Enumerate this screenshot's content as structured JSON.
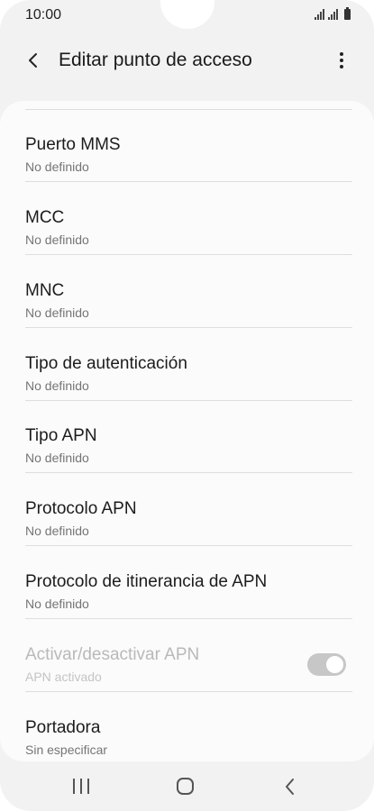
{
  "status_bar": {
    "time": "10:00"
  },
  "app_bar": {
    "title": "Editar punto de acceso",
    "back_icon": "chevron-left-icon",
    "more_icon": "more-vertical-icon"
  },
  "settings": {
    "items": [
      {
        "title": "Puerto MMS",
        "subtitle": "No definido",
        "enabled": true
      },
      {
        "title": "MCC",
        "subtitle": "No definido",
        "enabled": true
      },
      {
        "title": "MNC",
        "subtitle": "No definido",
        "enabled": true
      },
      {
        "title": "Tipo de autenticación",
        "subtitle": "No definido",
        "enabled": true
      },
      {
        "title": "Tipo APN",
        "subtitle": "No definido",
        "enabled": true
      },
      {
        "title": "Protocolo APN",
        "subtitle": "No definido",
        "enabled": true
      },
      {
        "title": "Protocolo de itinerancia de APN",
        "subtitle": "No definido",
        "enabled": true
      },
      {
        "title": "Activar/desactivar APN",
        "subtitle": "APN activado",
        "enabled": false,
        "toggle_on": true
      },
      {
        "title": "Portadora",
        "subtitle": "Sin especificar",
        "enabled": true
      }
    ]
  },
  "nav_bar": {
    "recents_icon": "recents-icon",
    "home_icon": "home-icon",
    "back_icon": "back-icon"
  },
  "colors": {
    "background": "#f2f2f2",
    "card": "#fbfbfb",
    "primary_text": "#1c1c1c",
    "secondary_text": "#757575",
    "disabled_text": "#b9b9b9"
  }
}
